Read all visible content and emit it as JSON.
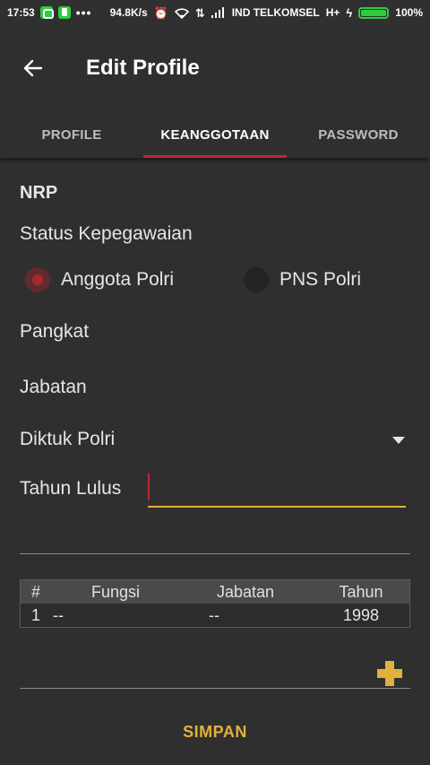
{
  "status_bar": {
    "time": "17:53",
    "speed": "94.8K/s",
    "carrier": "IND TELKOMSEL",
    "network": "H+",
    "battery_level": 1.0,
    "battery_text": "100%"
  },
  "appbar": {
    "title": "Edit Profile"
  },
  "tabs": [
    {
      "label": "PROFILE"
    },
    {
      "label": "KEANGGOTAAN",
      "active": true
    },
    {
      "label": "PASSWORD"
    }
  ],
  "form": {
    "nrp_label": "NRP",
    "status_label": "Status Kepegawaian",
    "radio_options": [
      {
        "label": "Anggota Polri",
        "checked": true
      },
      {
        "label": "PNS Polri",
        "checked": false
      }
    ],
    "pangkat_label": "Pangkat",
    "jabatan_label": "Jabatan",
    "diktuk_label": "Diktuk Polri",
    "tahun_lulus_label": "Tahun Lulus",
    "tahun_lulus_value": ""
  },
  "table": {
    "headers": [
      "#",
      "Fungsi",
      "Jabatan",
      "Tahun"
    ],
    "rows": [
      [
        "1",
        "--",
        "--",
        "1998"
      ]
    ]
  },
  "save_label": "SIMPAN",
  "colors": {
    "background": "#2f2f2f",
    "accent_red": "#c0262d",
    "accent_yellow": "#e0b23a",
    "battery_green": "#2ecc40"
  }
}
